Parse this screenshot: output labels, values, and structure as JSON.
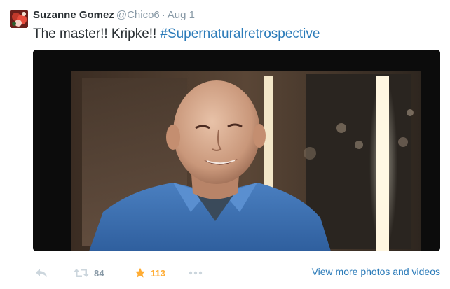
{
  "user": {
    "name": "Suzanne Gomez",
    "handle": "@Chico6",
    "separator": "·",
    "time": "Aug 1"
  },
  "tweet": {
    "text": "The master!! Kripke!!",
    "hashtag": "#Supernaturalretrospective"
  },
  "media": {
    "description_icon": "photo-of-smiling-bald-man-in-blue-shirt"
  },
  "actions": {
    "reply_icon": "reply-arrow-icon",
    "retweet_icon": "retweet-icon",
    "retweet_count": "84",
    "favorite_icon": "star-icon",
    "favorite_count": "113",
    "more_icon": "ellipsis-icon",
    "view_more": "View more photos and videos"
  },
  "colors": {
    "link": "#2b7bb9",
    "muted": "#8899a6",
    "favorite": "#ffac33",
    "text": "#292f33"
  }
}
